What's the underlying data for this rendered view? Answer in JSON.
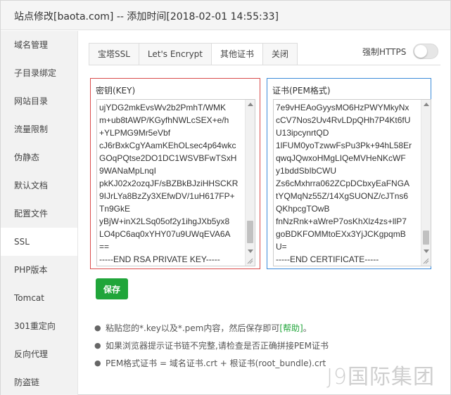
{
  "window": {
    "title": "站点修改[baota.com] -- 添加时间[2018-02-01 14:55:33]"
  },
  "sidebar": {
    "items": [
      {
        "label": "域名管理"
      },
      {
        "label": "子目录绑定"
      },
      {
        "label": "网站目录"
      },
      {
        "label": "流量限制"
      },
      {
        "label": "伪静态"
      },
      {
        "label": "默认文档"
      },
      {
        "label": "配置文件"
      },
      {
        "label": "SSL",
        "active": true
      },
      {
        "label": "PHP版本"
      },
      {
        "label": "Tomcat"
      },
      {
        "label": "301重定向"
      },
      {
        "label": "反向代理"
      },
      {
        "label": "防盗链"
      }
    ]
  },
  "tabs": [
    {
      "label": "宝塔SSL"
    },
    {
      "label": "Let's Encrypt"
    },
    {
      "label": "其他证书",
      "active": true
    },
    {
      "label": "关闭"
    }
  ],
  "force_https": {
    "label": "强制HTTPS",
    "enabled": false
  },
  "key_panel": {
    "label": "密钥(KEY)",
    "lines": [
      "ujYDG2mkEvsWv2b2PmhT/WMK",
      "m+ub8tAWP/KGyfhNWLcSEX+e/h",
      "+YLPMG9Mr5eVbf",
      "cJ6rBxkCgYAamKEhOLsec4p64wkc",
      "GOqPQtse2DO1DC1WSVBFwTSxH",
      "9WANaMpLnqI",
      "pkKJ02x2ozqJF/sBZBkBJziHHSCKR",
      "9IJrLYa8BzZy3XEfwDV/1uH617FP+",
      "Tn9GkE",
      "yBjW+inX2LSq05of2y1ihgJXb5yx8",
      "LO4pC6aq0xYHY07u9UWqEVA6A",
      "==",
      "-----END RSA PRIVATE KEY-----"
    ]
  },
  "cert_panel": {
    "label": "证书(PEM格式)",
    "lines": [
      "7e9vHEAoGyysMO6HzPWYMkyNx",
      "cCV7Nos2Uv4RvLDpQHh7P4Kt6fU",
      "U13ipcynrtQD",
      "1lFUM0yoTzwwFsPu3Pk+94hL58Er",
      "qwqJQwxoHMgLIQeMVHeNKcWF",
      "y1bddSbIbCWU",
      "Zs6cMxhrra062ZCpDCbxyEaFNGA",
      "tYQMqNz55Z/14XgSUONZ/cJTns6",
      "QKhpcgTOwB",
      "fnNzRnk+aWreP7osKhXlz4zs+llP7",
      "goBDKFOMMtoEXx3YjJCKgpqmB",
      "U=",
      "-----END CERTIFICATE-----"
    ]
  },
  "save_button": {
    "label": "保存"
  },
  "notes": {
    "note1_prefix": "粘贴您的*.key以及*.pem内容，然后保存即可",
    "note1_link": "[帮助]",
    "note1_suffix": "。",
    "note2": "如果浏览器提示证书链不完整,请检查是否正确拼接PEM证书",
    "note3": "PEM格式证书 = 域名证书.crt + 根证书(root_bundle).crt"
  },
  "watermark": "J9国际集团",
  "colors": {
    "primary_green": "#20a53a",
    "key_border": "#d94b4b",
    "cert_border": "#3b8ad9"
  }
}
